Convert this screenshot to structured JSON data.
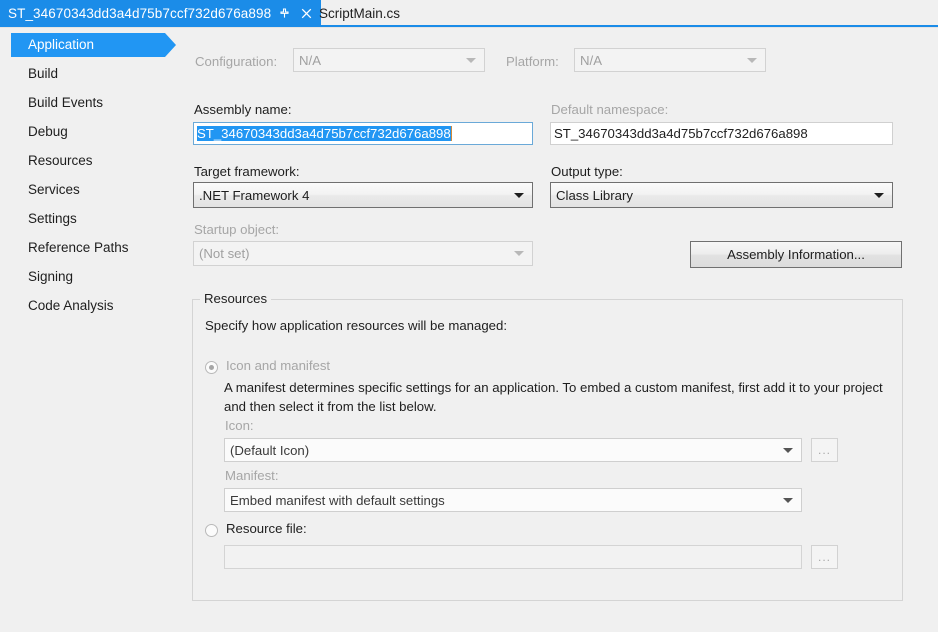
{
  "tabs": {
    "active": {
      "label": "ST_34670343dd3a4d75b7ccf732d676a898",
      "pin_icon": "pin-icon",
      "close_icon": "close-icon"
    },
    "inactive": {
      "label": "ScriptMain.cs"
    }
  },
  "sidebar": {
    "items": [
      {
        "label": "Application",
        "selected": true
      },
      {
        "label": "Build",
        "selected": false
      },
      {
        "label": "Build Events",
        "selected": false
      },
      {
        "label": "Debug",
        "selected": false
      },
      {
        "label": "Resources",
        "selected": false
      },
      {
        "label": "Services",
        "selected": false
      },
      {
        "label": "Settings",
        "selected": false
      },
      {
        "label": "Reference Paths",
        "selected": false
      },
      {
        "label": "Signing",
        "selected": false
      },
      {
        "label": "Code Analysis",
        "selected": false
      }
    ]
  },
  "toolbar": {
    "configuration_label": "Configuration:",
    "configuration_value": "N/A",
    "platform_label": "Platform:",
    "platform_value": "N/A"
  },
  "application": {
    "assembly_name_label": "Assembly name:",
    "assembly_name_value": "ST_34670343dd3a4d75b7ccf732d676a898",
    "default_namespace_label": "Default namespace:",
    "default_namespace_value": "ST_34670343dd3a4d75b7ccf732d676a898",
    "target_framework_label": "Target framework:",
    "target_framework_value": ".NET Framework 4",
    "output_type_label": "Output type:",
    "output_type_value": "Class Library",
    "startup_object_label": "Startup object:",
    "startup_object_value": "(Not set)",
    "assembly_information_button": "Assembly Information..."
  },
  "resources": {
    "group_title": "Resources",
    "intro": "Specify how application resources will be managed:",
    "icon_and_manifest_label": "Icon and manifest",
    "icon_and_manifest_selected": true,
    "manifest_description": "A manifest determines specific settings for an application. To embed a custom manifest, first add it to your project and then select it from the list below.",
    "icon_label": "Icon:",
    "icon_value": "(Default Icon)",
    "icon_browse_button": "...",
    "manifest_label": "Manifest:",
    "manifest_value": "Embed manifest with default settings",
    "resource_file_label": "Resource file:",
    "resource_file_selected": false,
    "resource_file_value": "",
    "resource_file_browse_button": "..."
  },
  "colors": {
    "accent_blue": "#1b8ce8",
    "selection_blue": "#2196f3",
    "window_bg": "#f0f0f0",
    "text": "#1e1e1e",
    "disabled_text": "#a6a6a6"
  }
}
